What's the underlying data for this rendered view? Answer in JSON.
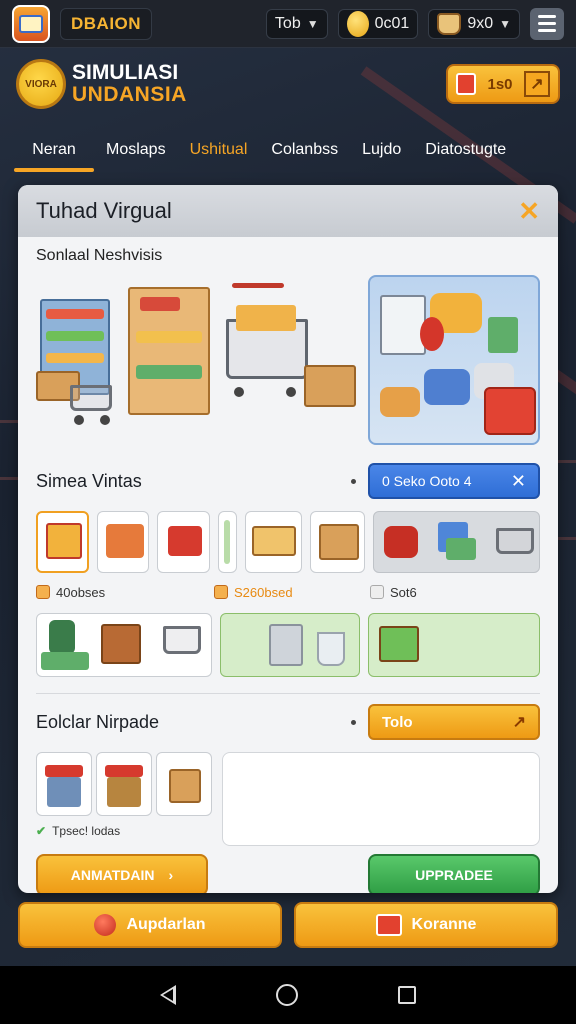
{
  "topbar": {
    "brand": "DBAION",
    "chip1_value": "Tob",
    "chip2_value": "0c01",
    "chip3_value": "9x0"
  },
  "header": {
    "logo_badge": "VIORA",
    "title_line1": "SIMULIASI",
    "title_line2": "UNDANSIA",
    "gift_value": "1s0"
  },
  "tabs": [
    {
      "label": "Neran"
    },
    {
      "label": "Moslaps"
    },
    {
      "label": "Ushitual"
    },
    {
      "label": "Colanbss"
    },
    {
      "label": "Lujdo"
    },
    {
      "label": "Diatostugte"
    }
  ],
  "modal": {
    "title": "Tuhad Virgual",
    "section1_label": "Sonlaal Neshvisis",
    "section2_title": "Simea Vintas",
    "blue_pill_label": "0  Seko Ooto 4",
    "label_a": "40obses",
    "label_b": "S260bsed",
    "label_c": "Sot6",
    "section3_title": "Eolclar Nirpade",
    "orange_pill_label": "Tolo",
    "small_label": "Tpsec! lodas",
    "button_left": "ANMATDAIN",
    "button_right": "UPPRADEE"
  },
  "footer": {
    "left_button": "Aupdarlan",
    "right_button": "Koranne"
  },
  "colors": {
    "accent": "#f6a525",
    "blue": "#2f6ed6",
    "green": "#2f9e45"
  }
}
